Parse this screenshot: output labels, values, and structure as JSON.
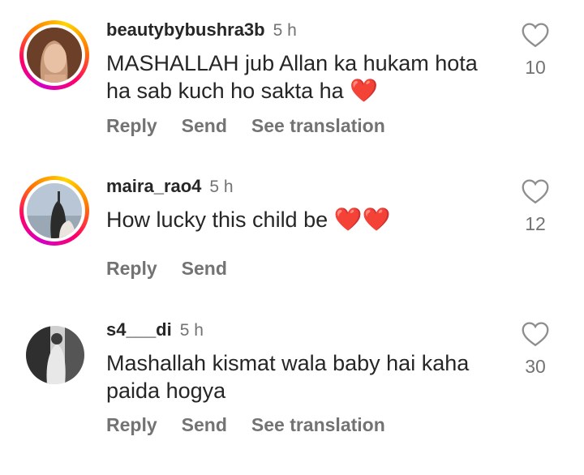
{
  "comments": [
    {
      "username": "beautybybushra3b",
      "time": "5 h",
      "text": "MASHALLAH jub Allan ka hukam hota ha sab kuch ho sakta ha",
      "emoji": "❤️",
      "likes": "10",
      "actions": [
        "Reply",
        "Send",
        "See translation"
      ]
    },
    {
      "username": "maira_rao4",
      "time": "5 h",
      "text": "How lucky this child be",
      "emoji": "❤️❤️",
      "likes": "12",
      "actions": [
        "Reply",
        "Send"
      ]
    },
    {
      "username": "s4___di",
      "time": "5 h",
      "text": "Mashallah kismat wala baby hai kaha paida hogya",
      "emoji": "",
      "likes": "30",
      "actions": [
        "Reply",
        "Send",
        "See translation"
      ]
    }
  ],
  "icons": {
    "like": "heart-outline-icon"
  },
  "colors": {
    "emoji_heart": "#e0202a",
    "secondary_text": "#737373"
  }
}
